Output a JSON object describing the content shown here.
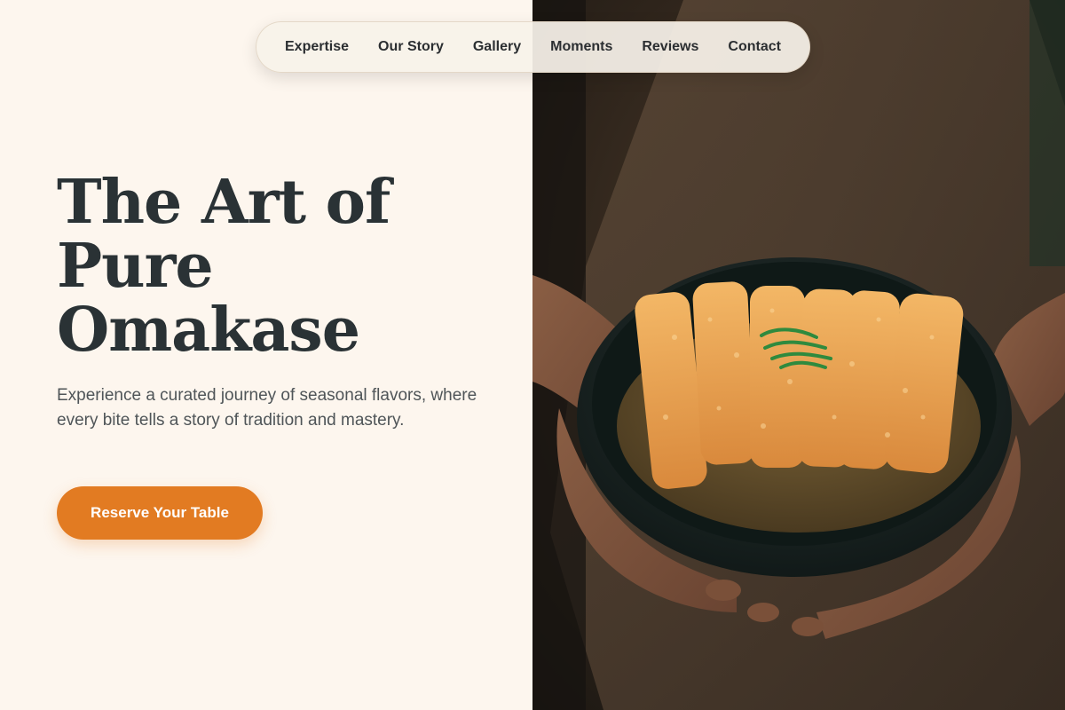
{
  "nav": {
    "items": [
      {
        "label": "Expertise"
      },
      {
        "label": "Our Story"
      },
      {
        "label": "Gallery"
      },
      {
        "label": "Moments"
      },
      {
        "label": "Reviews"
      },
      {
        "label": "Contact"
      }
    ]
  },
  "hero": {
    "title_lines": [
      "The Art of",
      "Pure",
      "Omakase"
    ],
    "subtitle": "Experience a curated journey of seasonal flavors, where every bite tells a story of tradition and mastery.",
    "cta_label": "Reserve Your Table"
  },
  "image": {
    "subject": "hands-holding-bowl-of-katsu-curry"
  },
  "colors": {
    "background": "#fdf6ee",
    "accent": "#e27b22",
    "heading": "#2a3235",
    "body_text": "#4f5558"
  }
}
